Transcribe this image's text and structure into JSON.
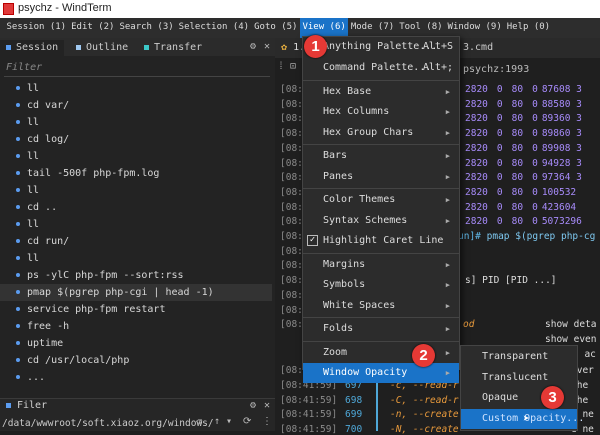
{
  "window": {
    "title": "psychz - WindTerm"
  },
  "menubar": [
    "Session (1)",
    "Edit (2)",
    "Search (3)",
    "Selection (4)",
    "Goto (5)",
    "View (6)",
    "Mode (7)",
    "Tool (8)",
    "Window (9)",
    "Help (0)"
  ],
  "left_tabs": [
    {
      "label": "Session",
      "color": "#5b9cf0"
    },
    {
      "label": "Outline",
      "color": "#9fc8f0"
    },
    {
      "label": "Transfer",
      "color": "#3cc8c8"
    }
  ],
  "filter_placeholder": "Filter",
  "history": [
    "ll",
    "cd var/",
    "ll",
    "cd log/",
    "ll",
    "tail -500f php-fpm.log",
    "ll",
    "cd ..",
    "ll",
    "cd run/",
    "ll",
    "ps -ylC php-fpm --sort:rss",
    "pmap $(pgrep php-cgi | head -1)",
    "service php-fpm restart",
    "free -h",
    "uptime",
    "cd /usr/local/php",
    "..."
  ],
  "filer": {
    "title": "Filer",
    "path": "/data/wwwroot/soft.xiaoz.org/windows/"
  },
  "terminal": {
    "tabs": [
      "1.",
      "3.cmd"
    ],
    "host": "psychz:1993",
    "ts_short": "[08:",
    "rows": [
      [
        "2820",
        "0",
        "80",
        "0",
        "87608 3"
      ],
      [
        "2820",
        "0",
        "80",
        "0",
        "88580 3"
      ],
      [
        "2820",
        "0",
        "80",
        "0",
        "89360 3"
      ],
      [
        "2820",
        "0",
        "80",
        "0",
        "89860 3"
      ],
      [
        "2820",
        "0",
        "80",
        "0",
        "89908 3"
      ],
      [
        "2820",
        "0",
        "80",
        "0",
        "94928 3"
      ],
      [
        "2820",
        "0",
        "80",
        "0",
        "97364 3"
      ],
      [
        "2820",
        "0",
        "80",
        "0",
        "100532"
      ],
      [
        "2820",
        "0",
        "80",
        "0",
        "423604"
      ],
      [
        "2820",
        "0",
        "80",
        "0",
        "5073296"
      ]
    ],
    "prompt_tail": "un]#",
    "command": "pmap $(pgrep php-cg",
    "usage": "s] PID [PID ...]",
    "opt_frag": "od",
    "desc": [
      "show deta",
      "show even",
      "s ac"
    ],
    "lower": [
      {
        "ts": "[08:41:59]",
        "ln": "696",
        "opt": "-XX",
        "desc": "ever"
      },
      {
        "ts": "[08:41:59]",
        "ln": "697",
        "opt": "-c, --read-r",
        "desc": "the"
      },
      {
        "ts": "[08:41:59]",
        "ln": "698",
        "opt": "-C, --read-r",
        "desc": "the"
      },
      {
        "ts": "[08:41:59]",
        "ln": "699",
        "opt": "-n, --create",
        "desc": "e ne"
      },
      {
        "ts": "[08:41:59]",
        "ln": "700",
        "opt": "-N, --create",
        "desc": "e ne"
      }
    ]
  },
  "view_menu": [
    {
      "label": "Anything Palette...",
      "shortcut": "Alt+S"
    },
    {
      "label": "Command Palette...",
      "shortcut": "Alt+;"
    },
    {
      "sep": true
    },
    {
      "label": "Hex Base",
      "sub": true
    },
    {
      "label": "Hex Columns",
      "sub": true
    },
    {
      "label": "Hex Group Chars",
      "sub": true
    },
    {
      "sep": true
    },
    {
      "label": "Bars",
      "sub": true
    },
    {
      "label": "Panes",
      "sub": true
    },
    {
      "sep": true
    },
    {
      "label": "Color Themes",
      "sub": true
    },
    {
      "label": "Syntax Schemes",
      "sub": true
    },
    {
      "label": "Highlight Caret Line",
      "checked": true
    },
    {
      "sep": true
    },
    {
      "label": "Margins",
      "sub": true
    },
    {
      "label": "Symbols",
      "sub": true
    },
    {
      "label": "White Spaces",
      "sub": true
    },
    {
      "sep": true
    },
    {
      "label": "Folds",
      "sub": true
    },
    {
      "sep": true
    },
    {
      "label": "Zoom",
      "sub": true
    },
    {
      "label": "Window Opacity",
      "sub": true,
      "highlighted": true
    }
  ],
  "opacity_submenu": [
    {
      "label": "Transparent"
    },
    {
      "label": "Translucent"
    },
    {
      "label": "Opaque"
    },
    {
      "label": "Custom Opacity...",
      "highlighted": true
    }
  ],
  "badges": [
    "1",
    "2",
    "3"
  ],
  "colors": {
    "accent": "#1a73c8",
    "badge": "#e53935"
  }
}
